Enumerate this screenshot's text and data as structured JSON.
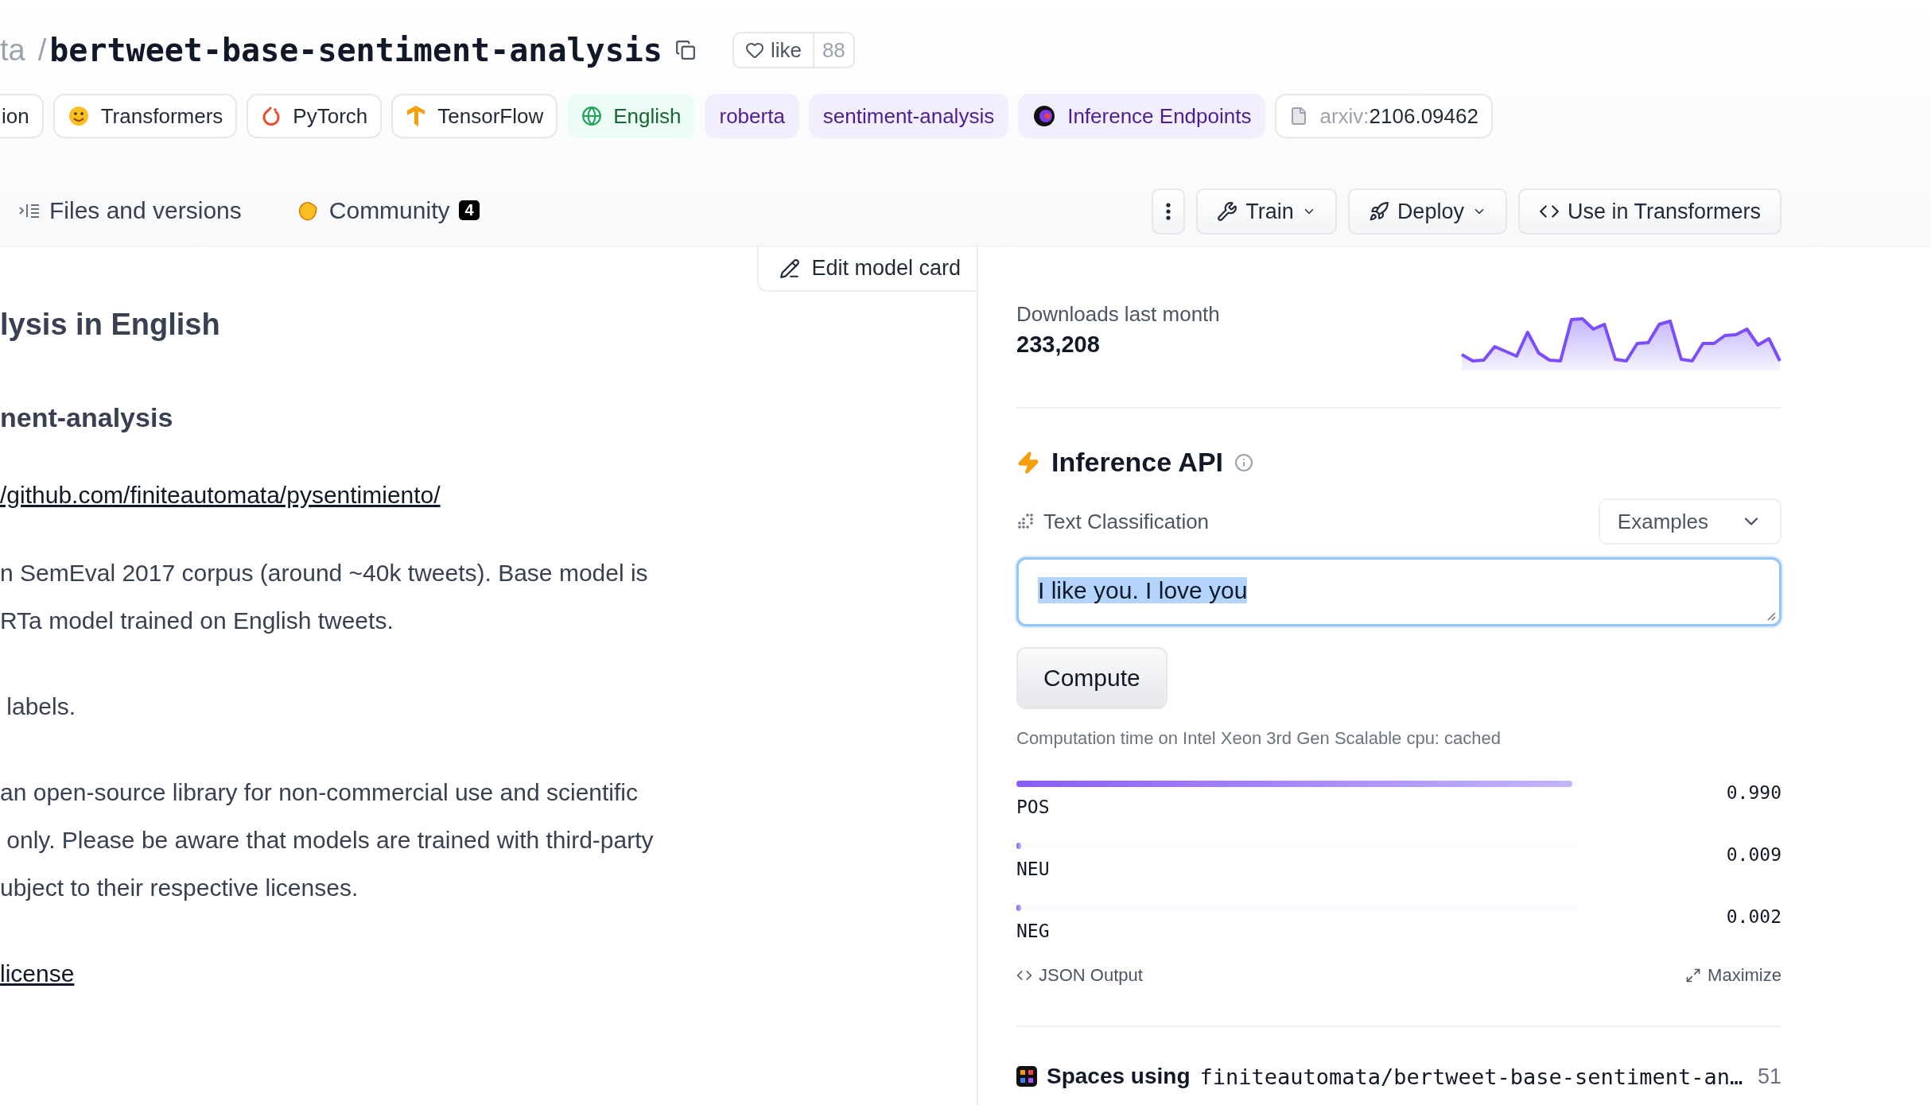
{
  "header": {
    "owner": "ta",
    "separator": "/",
    "model_name": "bertweet-base-sentiment-analysis",
    "like": {
      "label": "like",
      "count": "88"
    }
  },
  "tags": [
    {
      "kind": "plain",
      "label": "ion"
    },
    {
      "kind": "plain",
      "label": "Transformers"
    },
    {
      "kind": "plain",
      "label": "PyTorch"
    },
    {
      "kind": "plain",
      "label": "TensorFlow"
    },
    {
      "kind": "language",
      "label": "English"
    },
    {
      "kind": "topic",
      "label": "roberta"
    },
    {
      "kind": "topic",
      "label": "sentiment-analysis"
    },
    {
      "kind": "topic",
      "label": "Inference Endpoints"
    },
    {
      "kind": "paper",
      "prefix": "arxiv:",
      "label": "2106.09462"
    }
  ],
  "tabs": [
    {
      "label": "Files and versions",
      "selected": false
    },
    {
      "label": "Community",
      "selected": false,
      "badge": "4"
    }
  ],
  "actions": [
    {
      "kind": "more"
    },
    {
      "kind": "train",
      "label": "Train",
      "dropdown": true
    },
    {
      "kind": "deploy",
      "label": "Deploy",
      "dropdown": true
    },
    {
      "kind": "code",
      "label": "Use in Transformers",
      "dropdown": false
    }
  ],
  "model_card": {
    "edit_button": "Edit model card",
    "blocks": [
      {
        "kind": "heading",
        "text": "lysis in English"
      },
      {
        "kind": "subheading",
        "text": "nent-analysis"
      },
      {
        "kind": "link",
        "text": "/github.com/finiteautomata/pysentimiento/"
      },
      {
        "kind": "paragraph",
        "lines": [
          "n SemEval 2017 corpus (around ~40k tweets). Base model is",
          "RTa model trained on English tweets."
        ]
      },
      {
        "kind": "paragraph",
        "lines": [
          " labels."
        ]
      },
      {
        "kind": "paragraph",
        "lines": [
          "an open-source library for non-commercial use and scientific",
          " only. Please be aware that models are trained with third-party",
          "ubject to their respective licenses."
        ]
      },
      {
        "kind": "link",
        "text": "license"
      }
    ]
  },
  "downloads": {
    "label": "Downloads last month",
    "count": "233,208"
  },
  "inference": {
    "title": "Inference API",
    "task": "Text Classification",
    "examples": "Examples",
    "input": "I like you. I love you",
    "input_selected": true,
    "compute": "Compute",
    "timing": "Computation time on Intel Xeon 3rd Gen Scalable cpu: cached",
    "scores": [
      {
        "label": "POS",
        "value": "0.990",
        "level": 0.99
      },
      {
        "label": "NEU",
        "value": "0.009",
        "level": 0.009
      },
      {
        "label": "NEG",
        "value": "0.002",
        "level": 0.002
      }
    ],
    "json_output": "JSON Output",
    "maximize": "Maximize"
  },
  "spaces": {
    "label": "Spaces using",
    "model": "finiteautomata/bertweet-base-sentiment-an…",
    "count": "51"
  }
}
